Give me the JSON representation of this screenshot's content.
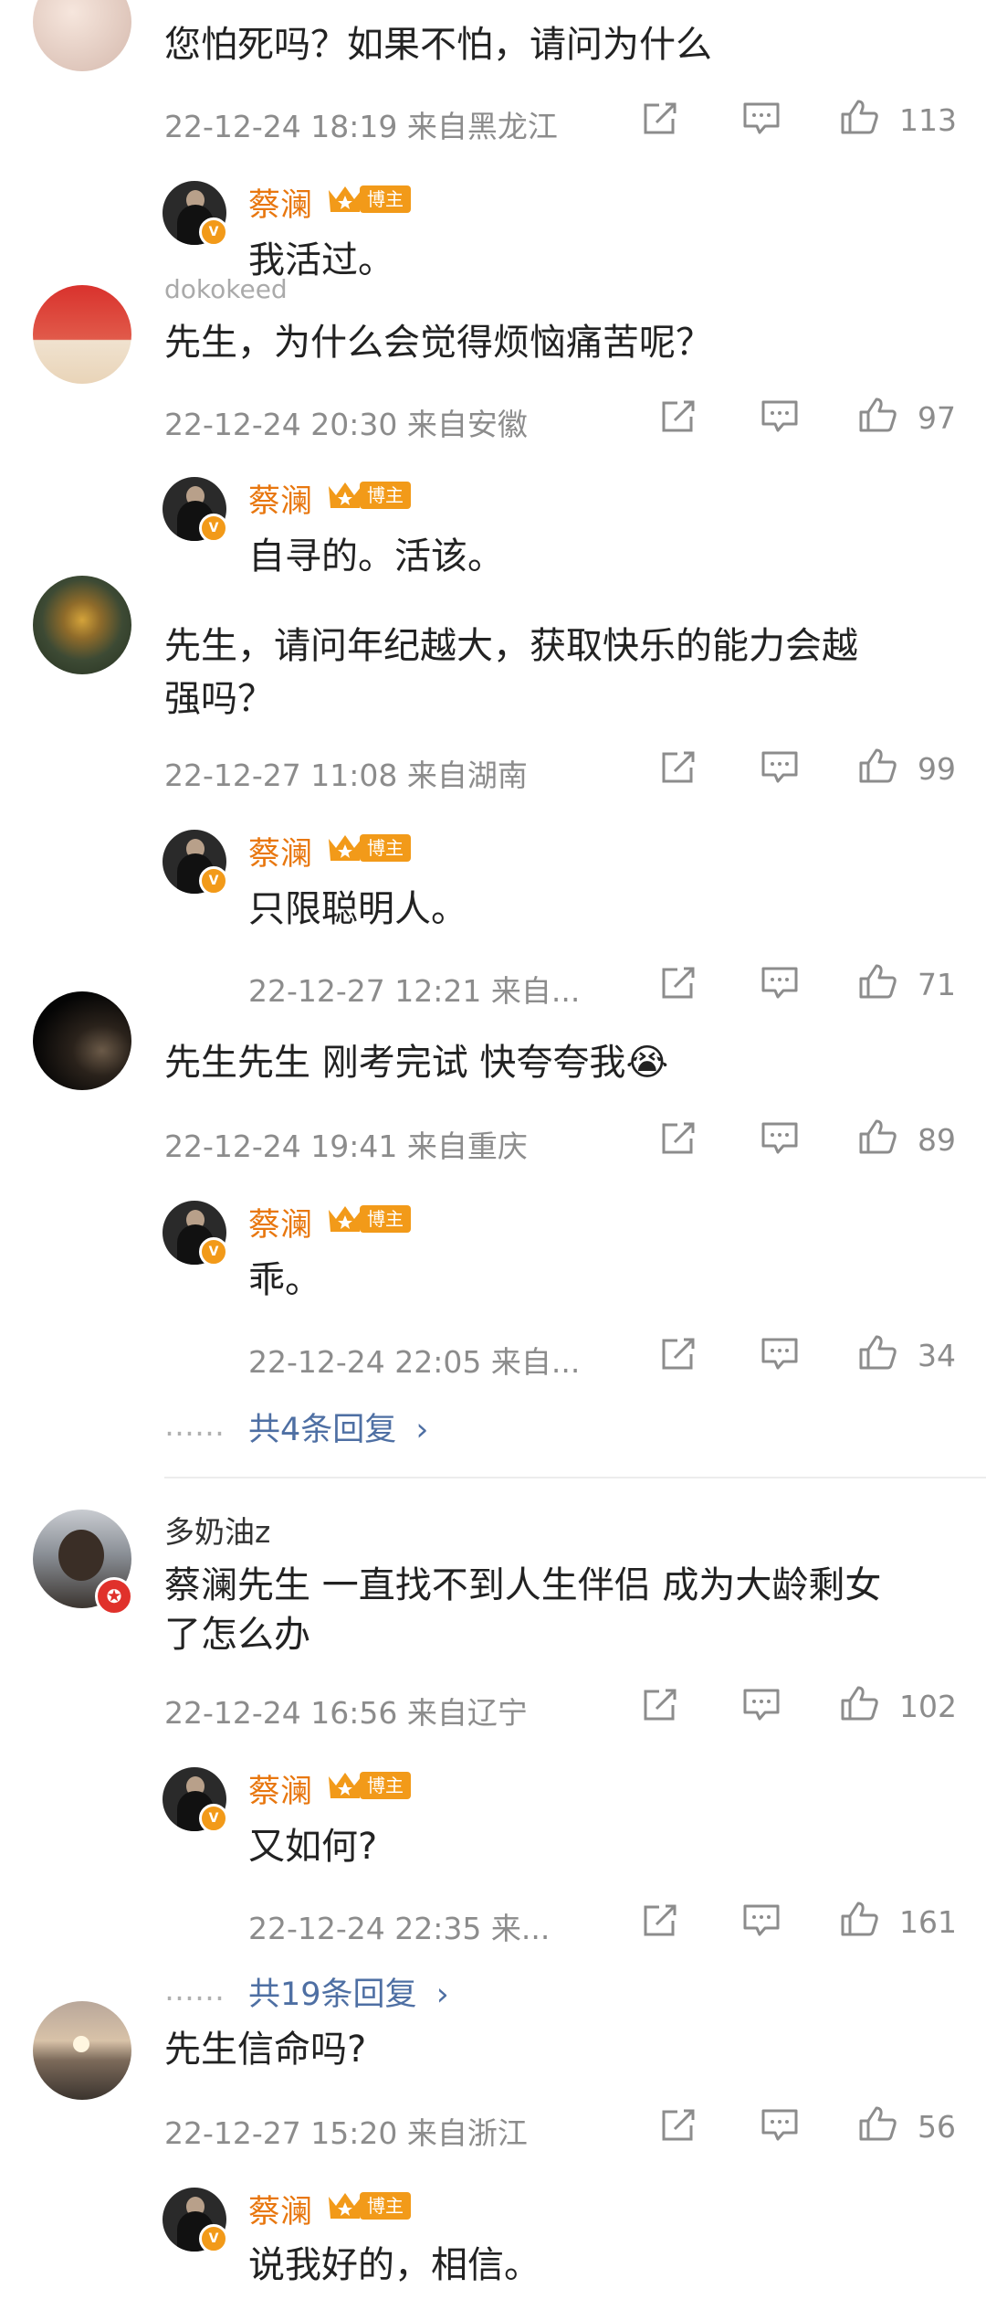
{
  "comments": [
    {
      "text": "您怕死吗？如果不怕，请问为什么",
      "time": "22-12-24 18:19",
      "loc": "来自黑龙江",
      "likes": "113",
      "reply": {
        "name": "蔡澜",
        "tag": "博主",
        "text": "我活过。"
      }
    },
    {
      "partial_name": "dokokeed",
      "text": "先生，为什么会觉得烦恼痛苦呢？",
      "time": "22-12-24 20:30",
      "loc": "来自安徽",
      "likes": "97",
      "reply": {
        "name": "蔡澜",
        "tag": "博主",
        "text": "自寻的。活该。"
      }
    },
    {
      "text_line1": "先生，请问年纪越大，获取快乐的能力会越",
      "text_line2": "强吗？",
      "time": "22-12-27 11:08",
      "loc": "来自湖南",
      "likes": "99",
      "reply": {
        "name": "蔡澜",
        "tag": "博主",
        "text": "只限聪明人。",
        "time": "22-12-27 12:21",
        "loc": "来自...",
        "likes": "71"
      }
    },
    {
      "text": "先生先生 刚考完试 快夸夸我",
      "emoji": "😭",
      "time": "22-12-24 19:41",
      "loc": "来自重庆",
      "likes": "89",
      "reply": {
        "name": "蔡澜",
        "tag": "博主",
        "text": "乖。",
        "time": "22-12-24 22:05",
        "loc": "来自...",
        "likes": "34"
      },
      "more": "共4条回复"
    },
    {
      "name": "多奶油z",
      "text_line1": "蔡澜先生 一直找不到人生伴侣 成为大龄剩女",
      "text_line2": "了怎么办",
      "time": "22-12-24 16:56",
      "loc": "来自辽宁",
      "likes": "102",
      "reply": {
        "name": "蔡澜",
        "tag": "博主",
        "text": "又如何?",
        "time": "22-12-24 22:35",
        "loc": "来...",
        "likes": "161"
      },
      "more": "共19条回复"
    },
    {
      "text": "先生信命吗?",
      "time": "22-12-27 15:20",
      "loc": "来自浙江",
      "likes": "56",
      "reply": {
        "name": "蔡澜",
        "tag": "博主",
        "text": "说我好的，相信。"
      }
    }
  ],
  "dots": "……",
  "arrow": "›",
  "icons": {
    "share": "share-icon",
    "comment": "comment-icon",
    "like": "thumbs-up-icon",
    "verified": "verified-v-icon",
    "crown": "crown-icon"
  },
  "colors": {
    "accent": "#e8770f",
    "link": "#4e6fa3",
    "meta": "#8c8c8c",
    "badge": "#f29a19"
  }
}
